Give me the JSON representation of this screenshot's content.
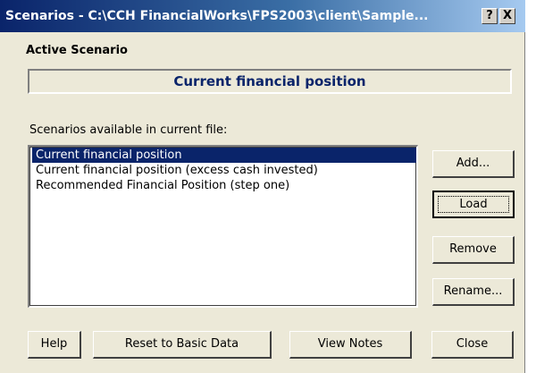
{
  "window": {
    "title": "Scenarios - C:\\CCH FinancialWorks\\FPS2003\\client\\Sample...",
    "help_glyph": "?",
    "close_glyph": "X"
  },
  "active_scenario": {
    "label": "Active Scenario",
    "value": "Current financial position"
  },
  "scenarios": {
    "label": "Scenarios available in current file:",
    "items": [
      "Current financial position",
      "Current financial position (excess cash invested)",
      "Recommended Financial Position (step one)"
    ],
    "selected_index": 0
  },
  "side_buttons": {
    "add": "Add...",
    "load": "Load",
    "remove": "Remove",
    "rename": "Rename..."
  },
  "bottom_buttons": {
    "help": "Help",
    "reset": "Reset to Basic Data",
    "view_notes": "View Notes",
    "close": "Close"
  },
  "colors": {
    "selection": "#0a246a",
    "dialog_face": "#ece9d8"
  }
}
